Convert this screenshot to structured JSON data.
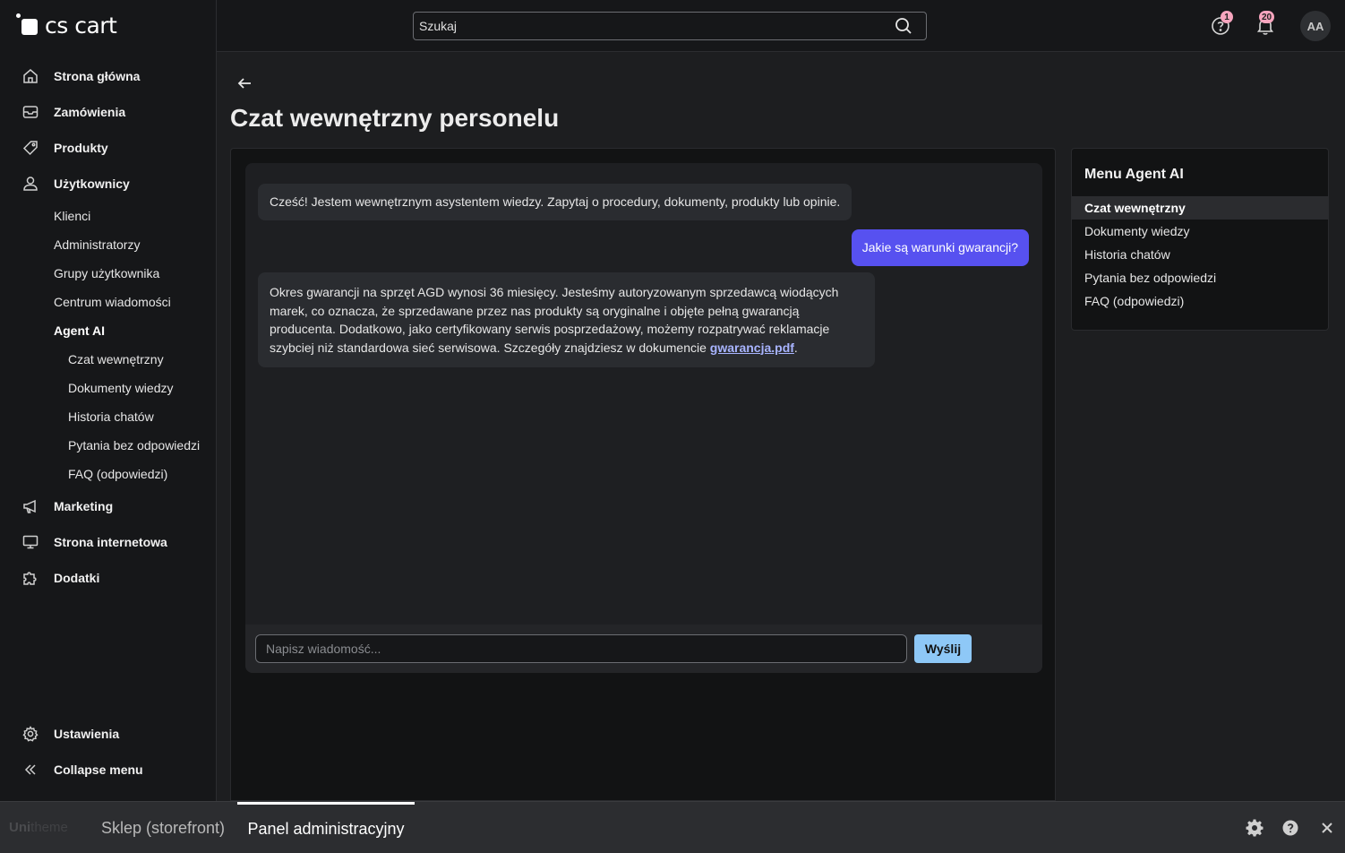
{
  "brand": {
    "logo_text": "cs cart"
  },
  "sidebar": {
    "main_items": [
      {
        "label": "Strona główna",
        "icon": "home-icon"
      },
      {
        "label": "Zamówienia",
        "icon": "inbox-icon"
      },
      {
        "label": "Produkty",
        "icon": "tag-icon"
      },
      {
        "label": "Użytkownicy",
        "icon": "user-icon"
      }
    ],
    "users_sub": [
      "Klienci",
      "Administratorzy",
      "Grupy użytkownika",
      "Centrum wiadomości"
    ],
    "agent_ai": {
      "label": "Agent AI",
      "items": [
        "Czat wewnętrzny",
        "Dokumenty wiedzy",
        "Historia chatów",
        "Pytania bez odpowiedzi",
        "FAQ (odpowiedzi)"
      ]
    },
    "more_items": [
      {
        "label": "Marketing",
        "icon": "megaphone-icon"
      },
      {
        "label": "Strona internetowa",
        "icon": "monitor-icon"
      },
      {
        "label": "Dodatki",
        "icon": "puzzle-icon"
      }
    ],
    "bottom_items": [
      {
        "label": "Ustawienia",
        "icon": "gear-icon"
      },
      {
        "label": "Collapse menu",
        "icon": "chevrons-left-icon"
      }
    ]
  },
  "topbar": {
    "search_placeholder": "Szukaj",
    "help_badge": "1",
    "notifications_badge": "20",
    "avatar_initials": "AA"
  },
  "page": {
    "title": "Czat wewnętrzny personelu"
  },
  "chat": {
    "messages": [
      {
        "role": "bot",
        "text": "Cześć! Jestem wewnętrznym asystentem wiedzy. Zapytaj o procedury, dokumenty, produkty lub opinie."
      },
      {
        "role": "user",
        "text": "Jakie są warunki gwarancji?"
      },
      {
        "role": "bot",
        "text": "Okres gwarancji na sprzęt AGD wynosi 36 miesięcy. Jesteśmy autoryzowanym sprzedawcą wiodących marek, co oznacza, że sprzedawane przez nas produkty są oryginalne i objęte pełną gwarancją producenta. Dodatkowo, jako certyfikowany serwis posprzedażowy, możemy rozpatrywać reklamacje szybciej niż standardowa sieć serwisowa. Szczegóły znajdziesz w dokumencie ",
        "link": "gwarancja.pdf",
        "suffix": "."
      }
    ],
    "input_placeholder": "Napisz wiadomość...",
    "send_label": "Wyślij"
  },
  "ai_menu": {
    "title": "Menu Agent AI",
    "items": [
      "Czat wewnętrzny",
      "Dokumenty wiedzy",
      "Historia chatów",
      "Pytania bez odpowiedzi",
      "FAQ (odpowiedzi)"
    ],
    "active_index": 0
  },
  "bottombar": {
    "logo_uni": "Uni",
    "logo_theme": "theme",
    "tab_store": "Sklep (storefront)",
    "tab_admin": "Panel administracyjny"
  }
}
